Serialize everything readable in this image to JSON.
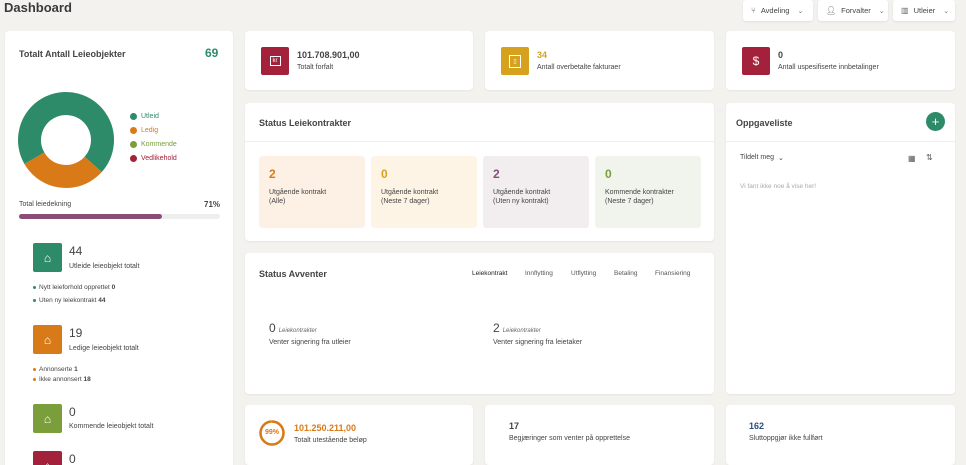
{
  "header": {
    "title": "Dashboard",
    "buttons": [
      {
        "icon": "branch-icon",
        "label": "Avdeling"
      },
      {
        "icon": "user-icon",
        "label": "Forvalter"
      },
      {
        "icon": "building-icon",
        "label": "Utleier"
      }
    ]
  },
  "colors": {
    "green": "#2e8b6a",
    "orange": "#d97a18",
    "olive": "#7a9e3a",
    "crimson": "#a3213a",
    "gold": "#d6a21e",
    "purple": "#8a4d7a"
  },
  "objects": {
    "title": "Totalt Antall Leieobjekter",
    "total": "69",
    "legend": [
      {
        "label": "Utleid",
        "color": "#2e8b6a"
      },
      {
        "label": "Ledig",
        "color": "#d97a18"
      },
      {
        "label": "Kommende",
        "color": "#7a9e3a"
      },
      {
        "label": "Vedlikehold",
        "color": "#a3213a"
      }
    ],
    "donut": [
      {
        "label": "Utleid",
        "value": 44
      },
      {
        "label": "Ledig",
        "value": 19
      },
      {
        "label": "Kommende",
        "value": 0
      },
      {
        "label": "Vedlikehold",
        "value": 0
      }
    ],
    "coverage_label": "Total leiedekning",
    "coverage_value": "71%",
    "coverage_fraction": 0.71,
    "rented": {
      "count": "44",
      "label": "Utleide leieobjekt totalt",
      "b1_label": "Nytt leieforhold opprettet",
      "b1_value": "0",
      "b2_label": "Uten ny leiekontrakt",
      "b2_value": "44"
    },
    "vacant": {
      "count": "19",
      "label": "Ledige leieobjekt totalt",
      "b1_label": "Annonserte",
      "b1_value": "1",
      "b2_label": "Ikke annonsert",
      "b2_value": "18"
    },
    "upcoming": {
      "count": "0",
      "label": "Kommende leieobjekt totalt"
    },
    "maintenance": {
      "count": "0"
    }
  },
  "stats": [
    {
      "icon": "currency-icon",
      "value": "101.708.901,00",
      "label": "Totalt forfalt"
    },
    {
      "icon": "invoice-icon",
      "value": "34",
      "label": "Antall overbetalte fakturaer"
    },
    {
      "icon": "dollar-icon",
      "value": "0",
      "label": "Antall uspesifiserte innbetalinger"
    }
  ],
  "contracts": {
    "title": "Status Leiekontrakter",
    "cards": [
      {
        "count": "2",
        "line1": "Utgående kontrakt",
        "line2": "(Alle)"
      },
      {
        "count": "0",
        "line1": "Utgående kontrakt",
        "line2": "(Neste 7 dager)"
      },
      {
        "count": "2",
        "line1": "Utgående kontrakt",
        "line2": "(Uten ny kontrakt)"
      },
      {
        "count": "0",
        "line1": "Kommende kontrakter",
        "line2": "(Neste 7 dager)"
      }
    ]
  },
  "pending": {
    "title": "Status Avventer",
    "tabs": [
      "Leiekontrakt",
      "Innflytting",
      "Utflytting",
      "Betaling",
      "Finansiering"
    ],
    "items": [
      {
        "count": "0",
        "unit": "Leiekontrakter",
        "label": "Venter signering fra utleier"
      },
      {
        "count": "2",
        "unit": "Leiekontrakter",
        "label": "Venter signering fra leietaker"
      }
    ]
  },
  "tasks": {
    "title": "Oppgaveliste",
    "filter": "Tildelt meg",
    "empty": "Vi fant ikke noe å vise her!"
  },
  "bottom": {
    "outstanding_percent": "99%",
    "outstanding_value": "101.250.211,00",
    "outstanding_label": "Totalt utestående beløp",
    "requests_value": "17",
    "requests_label": "Begjæringer som venter på opprettelse",
    "settlements_value": "162",
    "settlements_label": "Sluttoppgjør ikke fullført"
  }
}
